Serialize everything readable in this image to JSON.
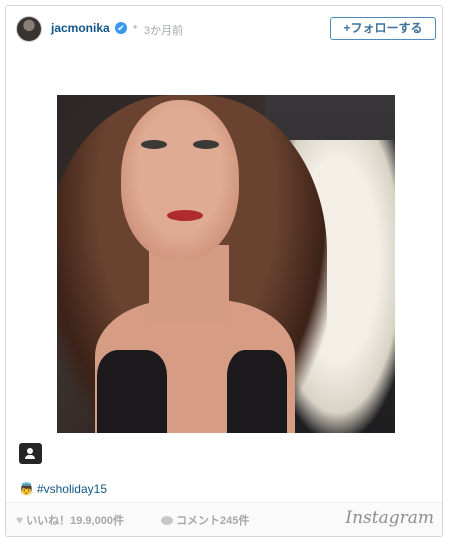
{
  "header": {
    "username": "jacmonika",
    "verified_badge": "✔",
    "separator": "•",
    "time_ago": "3か月前",
    "follow_label": "+フォローする"
  },
  "post": {
    "caption_emoji": "👼",
    "caption_hashtag": "#vsholiday15"
  },
  "footer": {
    "likes_icon": "♥",
    "likes_label": "いいね！19.9,000件",
    "comments_label": "コメント245件",
    "brand": "Instagram"
  },
  "icons": {
    "avatar": "avatar",
    "verified": "verified-icon",
    "user_tag": "user-tag-icon",
    "heart": "heart-icon",
    "comment": "comment-icon"
  },
  "colors": {
    "username": "#125688",
    "follow_border": "#4f8ac0",
    "verified": "#3897f0",
    "hashtag": "#125688"
  }
}
